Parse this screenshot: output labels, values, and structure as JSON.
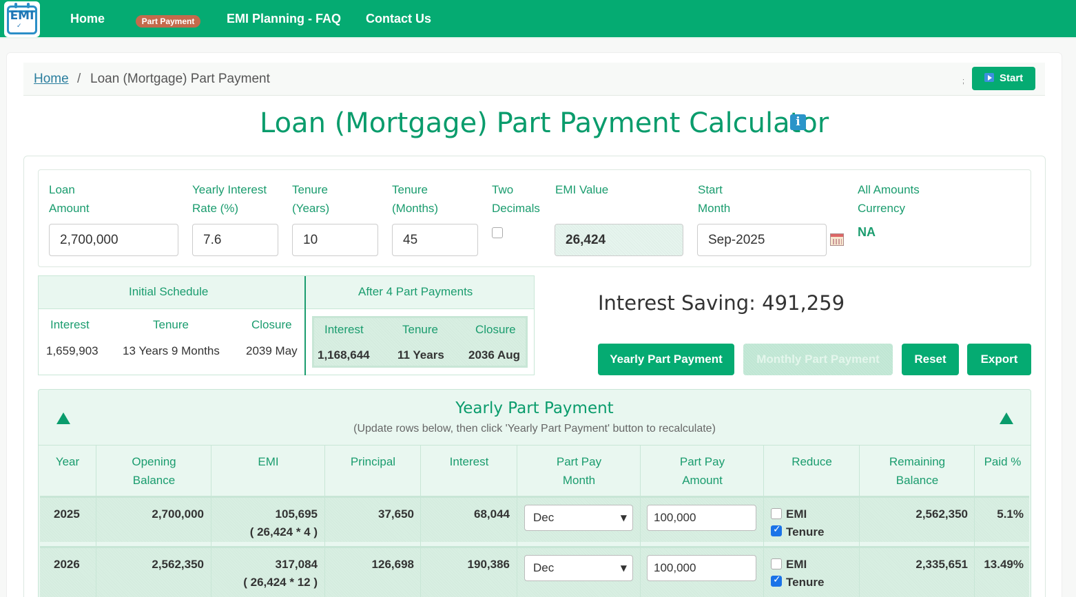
{
  "nav": {
    "logo_text": "EMI",
    "home": "Home",
    "part_payment": "Part Payment",
    "faq": "EMI Planning - FAQ",
    "contact": "Contact Us"
  },
  "breadcrumb": {
    "home": "Home",
    "separator": "/",
    "current": "Loan (Mortgage) Part Payment",
    "semicolon": ";",
    "start_label": "Start"
  },
  "page_title": "Loan (Mortgage) Part Payment Calculator",
  "info_icon": "i",
  "inputs": {
    "loan_amount_label_1": "Loan",
    "loan_amount_label_2": "Amount",
    "loan_amount_value": "2,700,000",
    "rate_label_1": "Yearly Interest",
    "rate_label_2": "Rate (%)",
    "rate_value": "7.6",
    "tenure_years_label_1": "Tenure",
    "tenure_years_label_2": "(Years)",
    "tenure_years_value": "10",
    "tenure_months_label_1": "Tenure",
    "tenure_months_label_2": "(Months)",
    "tenure_months_value": "45",
    "two_decimals_label_1": "Two",
    "two_decimals_label_2": "Decimals",
    "emi_label": "EMI Value",
    "emi_value": "26,424",
    "start_month_label_1": "Start",
    "start_month_label_2": "Month",
    "start_month_value": "Sep-2025",
    "currency_label_1": "All Amounts",
    "currency_label_2": "Currency",
    "currency_value": "NA"
  },
  "schedule": {
    "initial_title": "Initial Schedule",
    "after_title": "After 4 Part Payments",
    "col_interest": "Interest",
    "col_tenure": "Tenure",
    "col_closure": "Closure",
    "initial": {
      "interest": "1,659,903",
      "tenure": "13 Years 9 Months",
      "closure": "2039 May"
    },
    "after": {
      "interest": "1,168,644",
      "tenure": "11 Years",
      "closure": "2036 Aug"
    }
  },
  "saving": "Interest Saving: 491,259",
  "buttons": {
    "yearly": "Yearly Part Payment",
    "monthly": "Monthly Part Payment",
    "reset": "Reset",
    "export": "Export"
  },
  "yearly_table": {
    "title": "Yearly Part Payment",
    "subtitle": "(Update rows below, then click 'Yearly Part Payment' button to recalculate)",
    "headers": {
      "year": "Year",
      "opening_1": "Opening",
      "opening_2": "Balance",
      "emi": "EMI",
      "principal": "Principal",
      "interest": "Interest",
      "ppmonth_1": "Part Pay",
      "ppmonth_2": "Month",
      "ppamt_1": "Part Pay",
      "ppamt_2": "Amount",
      "reduce": "Reduce",
      "remaining_1": "Remaining",
      "remaining_2": "Balance",
      "paid": "Paid %"
    },
    "rows": [
      {
        "year": "2025",
        "opening": "2,700,000",
        "emi": "105,695",
        "emi_detail": "( 26,424 * 4 )",
        "principal": "37,650",
        "interest": "68,044",
        "month": "Dec",
        "amount": "100,000",
        "emi_opt": "EMI",
        "tenure_opt": "Tenure",
        "remaining": "2,562,350",
        "paid": "5.1%"
      },
      {
        "year": "2026",
        "opening": "2,562,350",
        "emi": "317,084",
        "emi_detail": "( 26,424 * 12 )",
        "principal": "126,698",
        "interest": "190,386",
        "month": "Dec",
        "amount": "100,000",
        "emi_opt": "EMI",
        "tenure_opt": "Tenure",
        "remaining": "2,335,651",
        "paid": "13.49%"
      }
    ]
  },
  "colors": {
    "brand": "#05ab72",
    "accent_text": "#1a9c6e",
    "pill": "#c46a4c"
  }
}
